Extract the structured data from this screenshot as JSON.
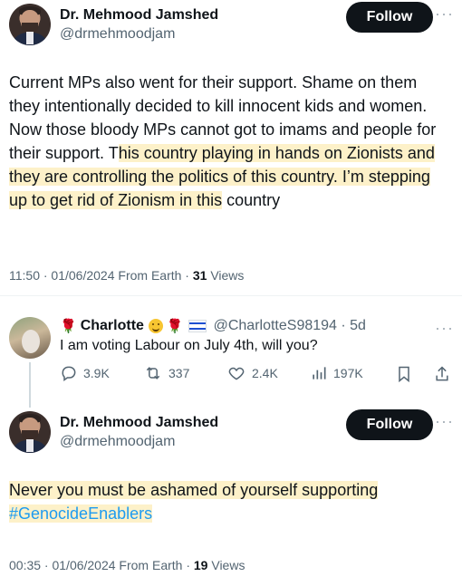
{
  "tweet1": {
    "author_name": "Dr. Mehmood Jamshed",
    "author_handle": "@drmehmoodjam",
    "follow_label": "Follow",
    "more": "···",
    "text_part1": "Current MPs also went for their support. Shame on them they intentionally decided to kill innocent kids and women. Now those bloody MPs cannot got to imams and people for their support. T",
    "text_highlight": "his country playing in hands on Zionists and they are controlling the politics of this country. I’m stepping up to get rid of Zionism in this",
    "text_part2": " country",
    "time": "11:50 · 01/06/2024 From Earth · ",
    "views_count": "31",
    "views_label": " Views"
  },
  "reply": {
    "author_name": "Charlotte",
    "handle_time": "@CharlotteS98194 · 5d",
    "more": "···",
    "text": "I am voting Labour on July 4th, will you?",
    "actions": {
      "replies": "3.9K",
      "reposts": "337",
      "likes": "2.4K",
      "views": "197K"
    }
  },
  "tweet2": {
    "author_name": "Dr. Mehmood Jamshed",
    "author_handle": "@drmehmoodjam",
    "follow_label": "Follow",
    "more": "···",
    "text": "Never you must be ashamed of yourself supporting",
    "hashtag": "#GenocideEnablers",
    "time": "00:35 · 01/06/2024 From Earth · ",
    "views_count": "19",
    "views_label": " Views"
  }
}
